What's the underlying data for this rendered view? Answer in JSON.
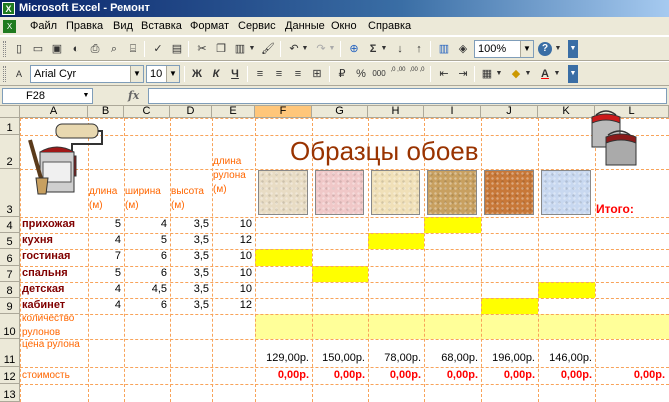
{
  "window": {
    "title": "Microsoft Excel - Ремонт",
    "app_icon": "X"
  },
  "menu": [
    "Файл",
    "Правка",
    "Вид",
    "Вставка",
    "Формат",
    "Сервис",
    "Данные",
    "Окно",
    "Справка"
  ],
  "toolbar": {
    "zoom": "100%",
    "font_name": "Arial Cyr",
    "font_size": "10",
    "bold": "Ж",
    "italic": "К",
    "underline": "Ч",
    "percent": "%",
    "thousands": "000",
    "inc_decimal": ",0 ,00",
    "dec_decimal": ",00 ,0"
  },
  "formula_bar": {
    "cell_ref": "F28",
    "fx": "fx",
    "value": ""
  },
  "columns": [
    "A",
    "B",
    "C",
    "D",
    "E",
    "F",
    "G",
    "H",
    "I",
    "J",
    "K",
    "L"
  ],
  "rows": [
    "1",
    "2",
    "3",
    "4",
    "5",
    "6",
    "7",
    "8",
    "9",
    "10",
    "11",
    "12",
    "13"
  ],
  "sheet": {
    "title": "Образцы обоев",
    "headers": {
      "length": "длина (м)",
      "width": "ширина (м)",
      "height": "высота (м)",
      "roll_length": "длина рулона (м)"
    },
    "itogo": "Итого:",
    "rooms": [
      {
        "name": "прихожая",
        "length": "5",
        "width": "4",
        "height": "3,5",
        "roll": "10"
      },
      {
        "name": "кухня",
        "length": "4",
        "width": "5",
        "height": "3,5",
        "roll": "12"
      },
      {
        "name": "гостиная",
        "length": "7",
        "width": "6",
        "height": "3,5",
        "roll": "10"
      },
      {
        "name": "спальня",
        "length": "5",
        "width": "6",
        "height": "3,5",
        "roll": "10"
      },
      {
        "name": "детская",
        "length": "4",
        "width": "4,5",
        "height": "3,5",
        "roll": "10"
      },
      {
        "name": "кабинет",
        "length": "4",
        "width": "6",
        "height": "3,5",
        "roll": "12"
      }
    ],
    "row10_label": "количество рулонов",
    "row11_label": "цена рулона",
    "row12_label": "стоимость",
    "prices": [
      "129,00р.",
      "150,00р.",
      "78,00р.",
      "68,00р.",
      "196,00р.",
      "146,00р."
    ],
    "costs": [
      "0,00р.",
      "0,00р.",
      "0,00р.",
      "0,00р.",
      "0,00р.",
      "0,00р."
    ],
    "total": "0,00р."
  },
  "colors": {
    "accent_title": "#993300",
    "orange_text": "#ff6600",
    "room_text": "#800000",
    "highlight": "#ffff00",
    "light_highlight": "#ffff99",
    "gridline": "#f8a35a"
  },
  "swatch_colors": [
    "#e8dcc4",
    "#f0c8c8",
    "#f0e0b8",
    "#c8a060",
    "#c87838",
    "#c8d8f0"
  ]
}
